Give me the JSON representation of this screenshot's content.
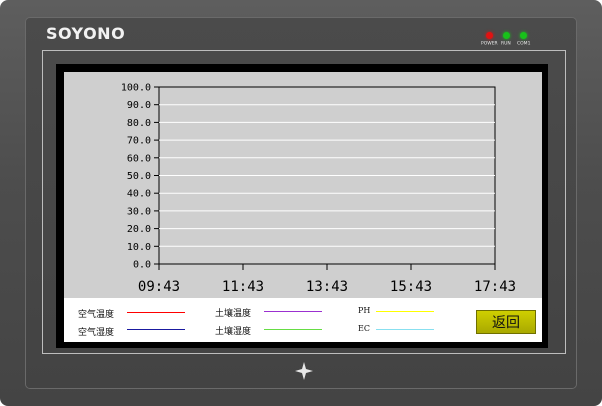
{
  "device": {
    "brand": "SOYONO",
    "indicators": [
      {
        "label": "POWER",
        "color": "#e11212"
      },
      {
        "label": "RUN",
        "color": "#18c21a"
      },
      {
        "label": "COM1",
        "color": "#18c21a"
      }
    ]
  },
  "chart_data": {
    "type": "line",
    "y_ticks": [
      "100.0",
      "90.0",
      "80.0",
      "70.0",
      "60.0",
      "50.0",
      "40.0",
      "30.0",
      "20.0",
      "10.0",
      "0.0"
    ],
    "x_ticks": [
      "09:43",
      "11:43",
      "13:43",
      "15:43",
      "17:43"
    ],
    "ylim": [
      0,
      100
    ],
    "grid": true,
    "series": []
  },
  "legend": {
    "items": [
      {
        "label": "空气温度",
        "color": "#ff0000"
      },
      {
        "label": "土壤温度",
        "color": "#9b30d0"
      },
      {
        "label": "PH",
        "color": "#ffff00"
      },
      {
        "label": "空气湿度",
        "color": "#1a1aa0"
      },
      {
        "label": "土壤湿度",
        "color": "#66dd44"
      },
      {
        "label": "EC",
        "color": "#88e0f0"
      }
    ]
  },
  "buttons": {
    "back_label": "返回"
  },
  "colors": {
    "plot_background": "#cfcfcf",
    "grid_line": "#ffffff",
    "button_yellow": "#c8c800"
  }
}
